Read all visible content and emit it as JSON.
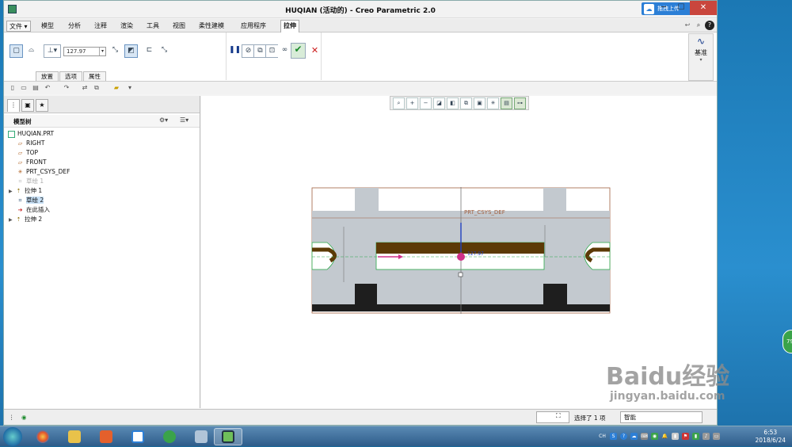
{
  "window": {
    "title": "HUQIAN (活动的) - Creo Parametric 2.0",
    "upload_label": "拖拽上传",
    "min": "─",
    "max": "☐",
    "close": "✕"
  },
  "menu": {
    "file": "文件 ▾",
    "tabs": [
      "模型",
      "分析",
      "注释",
      "渲染",
      "工具",
      "视图",
      "柔性建模",
      "应用程序"
    ],
    "active_tab": "拉伸"
  },
  "ribbon": {
    "depth_value": "127.97",
    "subtabs": [
      "放置",
      "选项",
      "属性"
    ],
    "datum_label": "基准"
  },
  "tree": {
    "header": "模型树",
    "items": [
      {
        "label": "HUQIAN.PRT",
        "icon": "part"
      },
      {
        "label": "RIGHT",
        "icon": "plane"
      },
      {
        "label": "TOP",
        "icon": "plane"
      },
      {
        "label": "FRONT",
        "icon": "plane"
      },
      {
        "label": "PRT_CSYS_DEF",
        "icon": "csys"
      },
      {
        "label": "草绘 1",
        "icon": "sketch"
      },
      {
        "label": "拉伸 1",
        "icon": "extrude"
      },
      {
        "label": "草绘 2",
        "icon": "sketch"
      },
      {
        "label": "在此插入",
        "icon": "insert"
      },
      {
        "label": "拉伸 2",
        "icon": "extrude"
      }
    ]
  },
  "canvas": {
    "csys_label": "PRT_CSYS_DEF",
    "dim_label": "127.97"
  },
  "status": {
    "selected": "选择了 1 项",
    "filter": "智能"
  },
  "taskbar": {
    "time": "6:53",
    "date": "2018/6/24",
    "lang": "CH"
  },
  "overlay": {
    "bubble": "79"
  },
  "watermark": {
    "brand": "Baidu经验",
    "url": "jingyan.baidu.com"
  },
  "colors": {
    "part_gray": "#c3c9cf",
    "part_dark": "#1e1e1e",
    "brown": "#5c3a06",
    "accent_green": "#3aa34a"
  }
}
